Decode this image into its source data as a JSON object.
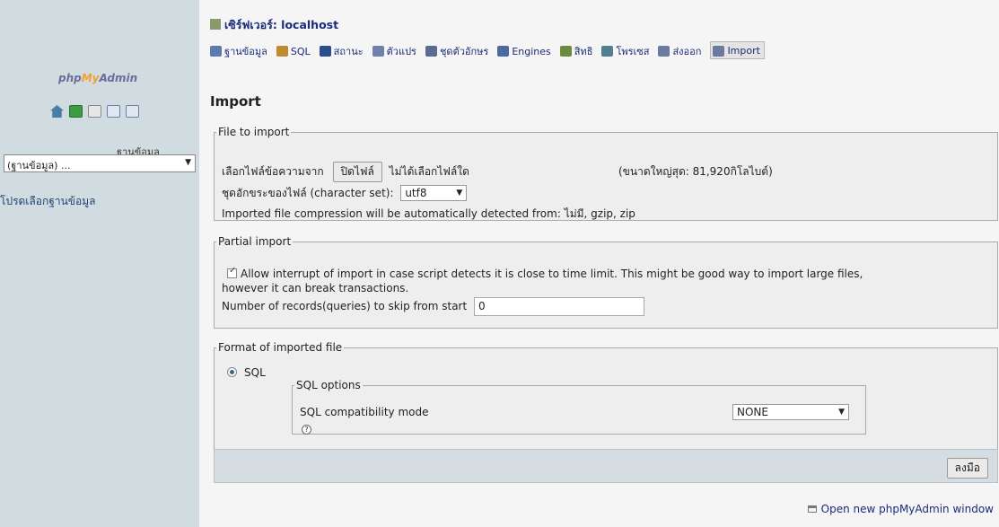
{
  "left": {
    "logo_parts": [
      "php",
      "My",
      "Admin"
    ],
    "icons": [
      "home-icon",
      "table-icon",
      "sql-icon",
      "docs-icon",
      "changelog-icon"
    ],
    "db_label": "ฐานข้อมูล",
    "db_select_value": "(ฐานข้อมูล) ...",
    "pick_db_text": "โปรดเลือกฐานข้อมูล"
  },
  "main": {
    "server_title": "เซิร์ฟเวอร์: localhost",
    "tabs": [
      {
        "label": "ฐานข้อมูล",
        "icon": "database-icon",
        "color": "#5a7ab0"
      },
      {
        "label": "SQL",
        "icon": "sql-icon",
        "color": "#c08a30"
      },
      {
        "label": "สถานะ",
        "icon": "status-icon",
        "color": "#2c4c90"
      },
      {
        "label": "ตัวแปร",
        "icon": "variables-icon",
        "color": "#7080a8"
      },
      {
        "label": "ชุดตัวอักษร",
        "icon": "charset-icon",
        "color": "#5a6a90"
      },
      {
        "label": "Engines",
        "icon": "engines-icon",
        "color": "#4a6aa0"
      },
      {
        "label": "สิทธิ",
        "icon": "privileges-icon",
        "color": "#6a8a40"
      },
      {
        "label": "โพรเซส",
        "icon": "process-icon",
        "color": "#508090"
      },
      {
        "label": "ส่งออก",
        "icon": "export-icon",
        "color": "#6a7aa0"
      },
      {
        "label": "Import",
        "icon": "import-icon",
        "color": "#6a7aa0",
        "active": true
      }
    ],
    "page_title": "Import",
    "file_section": {
      "legend": "File to import",
      "file_label": "เลือกไฟล์ข้อความจาก",
      "browse_button": "ปิดไฟล์",
      "no_file_text": "ไม่ได้เลือกไฟล์ใด",
      "max_size_text": "(ขนาดใหญ่สุด: 81,920กิโลไบต์)",
      "charset_label": "ชุดอักขระของไฟล์ (character set):",
      "charset_value": "utf8",
      "compression_text": "Imported file compression will be automatically detected from: ไม่มี, gzip, zip"
    },
    "partial_section": {
      "legend": "Partial import",
      "allow_interrupt_text": "Allow interrupt of import in case script detects it is close to time limit. This might be good way to import large files,",
      "allow_interrupt_text2": "however it can break transactions.",
      "allow_interrupt_checked": true,
      "skip_label": "Number of records(queries) to skip from start",
      "skip_value": "0"
    },
    "format_section": {
      "legend": "Format of imported file",
      "format_option": "SQL",
      "sql_options_legend": "SQL options",
      "compat_label": "SQL compatibility mode",
      "compat_value": "NONE"
    },
    "submit_button": "ลงมือ",
    "open_new_window": "Open new phpMyAdmin window"
  },
  "colors": {
    "left_bg": "#d0dce0",
    "main_bg": "#f5f5f5",
    "fieldset_bg": "#eeeeee",
    "link": "#1a2b7a",
    "logo_accent": "#f3a030"
  }
}
